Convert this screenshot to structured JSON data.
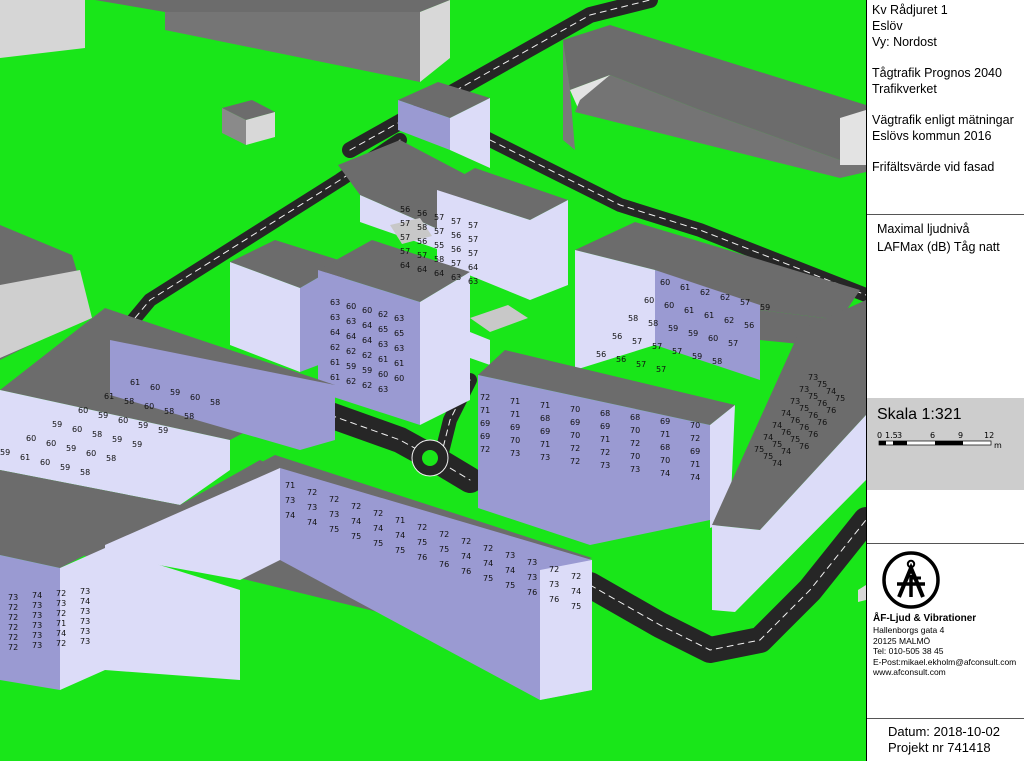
{
  "project": {
    "title": "Kv Rådjuret 1",
    "city": "Eslöv",
    "view": "Vy: Nordost",
    "train_forecast": "Tågtrafik Prognos 2040",
    "train_source": "Trafikverket",
    "road_traffic": "Vägtrafik enligt mätningar",
    "road_source": "Eslövs kommun 2016",
    "facade_note": "Frifältsvärde vid fasad"
  },
  "metric": {
    "line1": "Maximal ljudnivå",
    "line2": "LAFMax (dB) Tåg natt"
  },
  "scale": {
    "title": "Skala 1:321",
    "ticks": [
      "0",
      "1.5",
      "3",
      "6",
      "9",
      "12"
    ],
    "unit": "m"
  },
  "company": {
    "name": "ÅF-Ljud & Vibrationer",
    "street": "Hallenborgs gata 4",
    "postal": "20125 MALMÖ",
    "phone": "Tel: 010-505 38 45",
    "email": "E-Post:mikael.ekholm@afconsult.com",
    "web": "www.afconsult.com"
  },
  "footer": {
    "date": "Datum: 2018-10-02",
    "project_no": "Projekt nr 741418"
  },
  "colors": {
    "ground": "#19e619",
    "roof": "#6c6c6c",
    "facade_light": "#dcdcf8",
    "facade_dark": "#9a9ad2",
    "road": "#262626"
  },
  "map": {
    "facade_levels": [
      {
        "group": "front-left-building",
        "values": [
          "73",
          "74",
          "72",
          "73",
          "72",
          "73",
          "73",
          "74",
          "72",
          "73",
          "72",
          "73",
          "72",
          "73",
          "71",
          "73",
          "72",
          "73",
          "74",
          "73",
          "72",
          "73",
          "72",
          "73"
        ]
      },
      {
        "group": "center-long-building",
        "values": [
          "71",
          "72",
          "72",
          "72",
          "72",
          "71",
          "72",
          "72",
          "72",
          "72",
          "73",
          "73",
          "72",
          "72",
          "73",
          "73",
          "73",
          "74",
          "74",
          "74",
          "75",
          "75",
          "74",
          "74",
          "74",
          "73",
          "73",
          "74",
          "74",
          "74",
          "75",
          "75",
          "75",
          "75",
          "76",
          "76",
          "76",
          "75",
          "75",
          "76",
          "76",
          "75"
        ]
      },
      {
        "group": "center-right-building",
        "values": [
          "72",
          "71",
          "71",
          "70",
          "68",
          "68",
          "69",
          "70",
          "71",
          "71",
          "68",
          "69",
          "69",
          "70",
          "71",
          "72",
          "69",
          "69",
          "69",
          "70",
          "71",
          "72",
          "68",
          "69",
          "69",
          "70",
          "71",
          "72",
          "72",
          "70",
          "70",
          "71",
          "72",
          "73",
          "73",
          "72",
          "73",
          "73",
          "74",
          "74"
        ]
      },
      {
        "group": "right-building",
        "values": [
          "73",
          "73",
          "73",
          "74",
          "74",
          "74",
          "75",
          "75",
          "75",
          "75",
          "76",
          "76",
          "75",
          "75",
          "74",
          "76",
          "76",
          "76",
          "75",
          "74",
          "74",
          "75",
          "76",
          "76",
          "76",
          "76"
        ]
      },
      {
        "group": "left-building",
        "values": [
          "61",
          "61",
          "60",
          "59",
          "60",
          "59",
          "60",
          "58",
          "59",
          "60",
          "60",
          "61",
          "59",
          "60",
          "60",
          "58",
          "59",
          "60",
          "60",
          "58",
          "59",
          "59",
          "60",
          "59",
          "58",
          "58",
          "59",
          "59",
          "58",
          "58"
        ]
      },
      {
        "group": "courtyard-right",
        "values": [
          "60",
          "61",
          "62",
          "62",
          "57",
          "59",
          "60",
          "60",
          "61",
          "61",
          "62",
          "56",
          "58",
          "58",
          "59",
          "59",
          "60",
          "57",
          "56",
          "57",
          "57",
          "57",
          "59",
          "58",
          "56",
          "56",
          "57",
          "57"
        ]
      },
      {
        "group": "courtyard-center",
        "values": [
          "63",
          "60",
          "60",
          "62",
          "63",
          "63",
          "63",
          "64",
          "65",
          "65",
          "64",
          "64",
          "64",
          "63",
          "63",
          "62",
          "62",
          "62",
          "61",
          "61",
          "61",
          "59",
          "59",
          "60",
          "60",
          "61",
          "62",
          "62",
          "63"
        ]
      },
      {
        "group": "back-buildings",
        "values": [
          "56",
          "56",
          "57",
          "57",
          "57",
          "57",
          "58",
          "57",
          "56",
          "57",
          "57",
          "56",
          "55",
          "56",
          "57",
          "57",
          "57",
          "58",
          "57",
          "64",
          "64",
          "64",
          "64",
          "63",
          "63"
        ]
      }
    ]
  }
}
